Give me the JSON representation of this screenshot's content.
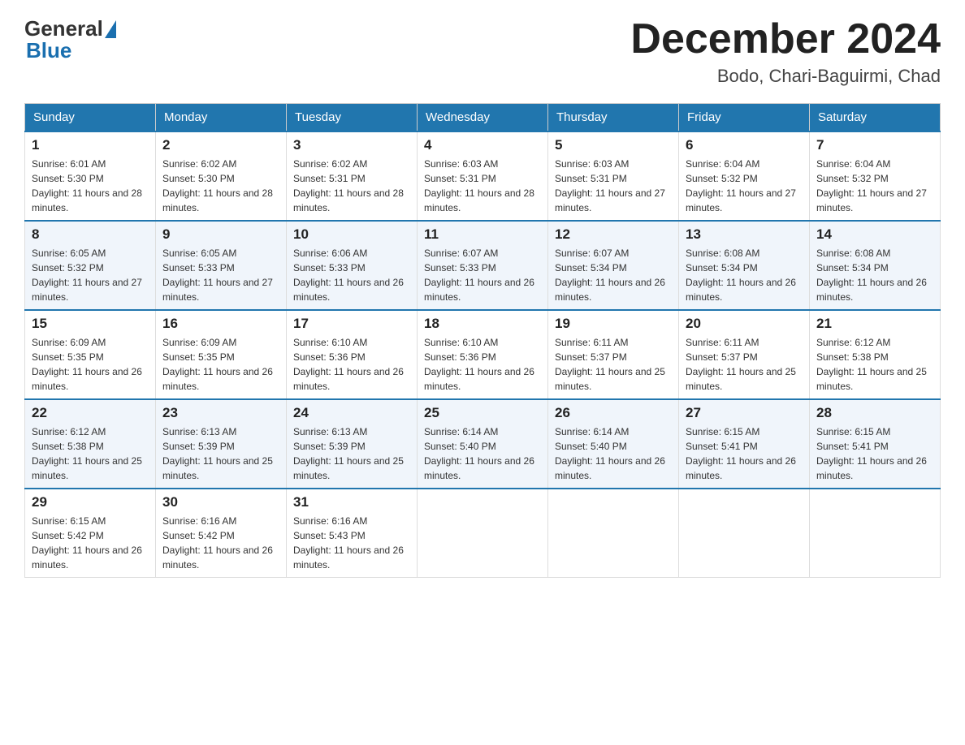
{
  "header": {
    "logo": {
      "general": "General",
      "blue": "Blue"
    },
    "month_title": "December 2024",
    "location": "Bodo, Chari-Baguirmi, Chad"
  },
  "weekdays": [
    "Sunday",
    "Monday",
    "Tuesday",
    "Wednesday",
    "Thursday",
    "Friday",
    "Saturday"
  ],
  "weeks": [
    [
      {
        "day": "1",
        "sunrise": "6:01 AM",
        "sunset": "5:30 PM",
        "daylight": "11 hours and 28 minutes."
      },
      {
        "day": "2",
        "sunrise": "6:02 AM",
        "sunset": "5:30 PM",
        "daylight": "11 hours and 28 minutes."
      },
      {
        "day": "3",
        "sunrise": "6:02 AM",
        "sunset": "5:31 PM",
        "daylight": "11 hours and 28 minutes."
      },
      {
        "day": "4",
        "sunrise": "6:03 AM",
        "sunset": "5:31 PM",
        "daylight": "11 hours and 28 minutes."
      },
      {
        "day": "5",
        "sunrise": "6:03 AM",
        "sunset": "5:31 PM",
        "daylight": "11 hours and 27 minutes."
      },
      {
        "day": "6",
        "sunrise": "6:04 AM",
        "sunset": "5:32 PM",
        "daylight": "11 hours and 27 minutes."
      },
      {
        "day": "7",
        "sunrise": "6:04 AM",
        "sunset": "5:32 PM",
        "daylight": "11 hours and 27 minutes."
      }
    ],
    [
      {
        "day": "8",
        "sunrise": "6:05 AM",
        "sunset": "5:32 PM",
        "daylight": "11 hours and 27 minutes."
      },
      {
        "day": "9",
        "sunrise": "6:05 AM",
        "sunset": "5:33 PM",
        "daylight": "11 hours and 27 minutes."
      },
      {
        "day": "10",
        "sunrise": "6:06 AM",
        "sunset": "5:33 PM",
        "daylight": "11 hours and 26 minutes."
      },
      {
        "day": "11",
        "sunrise": "6:07 AM",
        "sunset": "5:33 PM",
        "daylight": "11 hours and 26 minutes."
      },
      {
        "day": "12",
        "sunrise": "6:07 AM",
        "sunset": "5:34 PM",
        "daylight": "11 hours and 26 minutes."
      },
      {
        "day": "13",
        "sunrise": "6:08 AM",
        "sunset": "5:34 PM",
        "daylight": "11 hours and 26 minutes."
      },
      {
        "day": "14",
        "sunrise": "6:08 AM",
        "sunset": "5:34 PM",
        "daylight": "11 hours and 26 minutes."
      }
    ],
    [
      {
        "day": "15",
        "sunrise": "6:09 AM",
        "sunset": "5:35 PM",
        "daylight": "11 hours and 26 minutes."
      },
      {
        "day": "16",
        "sunrise": "6:09 AM",
        "sunset": "5:35 PM",
        "daylight": "11 hours and 26 minutes."
      },
      {
        "day": "17",
        "sunrise": "6:10 AM",
        "sunset": "5:36 PM",
        "daylight": "11 hours and 26 minutes."
      },
      {
        "day": "18",
        "sunrise": "6:10 AM",
        "sunset": "5:36 PM",
        "daylight": "11 hours and 26 minutes."
      },
      {
        "day": "19",
        "sunrise": "6:11 AM",
        "sunset": "5:37 PM",
        "daylight": "11 hours and 25 minutes."
      },
      {
        "day": "20",
        "sunrise": "6:11 AM",
        "sunset": "5:37 PM",
        "daylight": "11 hours and 25 minutes."
      },
      {
        "day": "21",
        "sunrise": "6:12 AM",
        "sunset": "5:38 PM",
        "daylight": "11 hours and 25 minutes."
      }
    ],
    [
      {
        "day": "22",
        "sunrise": "6:12 AM",
        "sunset": "5:38 PM",
        "daylight": "11 hours and 25 minutes."
      },
      {
        "day": "23",
        "sunrise": "6:13 AM",
        "sunset": "5:39 PM",
        "daylight": "11 hours and 25 minutes."
      },
      {
        "day": "24",
        "sunrise": "6:13 AM",
        "sunset": "5:39 PM",
        "daylight": "11 hours and 25 minutes."
      },
      {
        "day": "25",
        "sunrise": "6:14 AM",
        "sunset": "5:40 PM",
        "daylight": "11 hours and 26 minutes."
      },
      {
        "day": "26",
        "sunrise": "6:14 AM",
        "sunset": "5:40 PM",
        "daylight": "11 hours and 26 minutes."
      },
      {
        "day": "27",
        "sunrise": "6:15 AM",
        "sunset": "5:41 PM",
        "daylight": "11 hours and 26 minutes."
      },
      {
        "day": "28",
        "sunrise": "6:15 AM",
        "sunset": "5:41 PM",
        "daylight": "11 hours and 26 minutes."
      }
    ],
    [
      {
        "day": "29",
        "sunrise": "6:15 AM",
        "sunset": "5:42 PM",
        "daylight": "11 hours and 26 minutes."
      },
      {
        "day": "30",
        "sunrise": "6:16 AM",
        "sunset": "5:42 PM",
        "daylight": "11 hours and 26 minutes."
      },
      {
        "day": "31",
        "sunrise": "6:16 AM",
        "sunset": "5:43 PM",
        "daylight": "11 hours and 26 minutes."
      },
      null,
      null,
      null,
      null
    ]
  ]
}
